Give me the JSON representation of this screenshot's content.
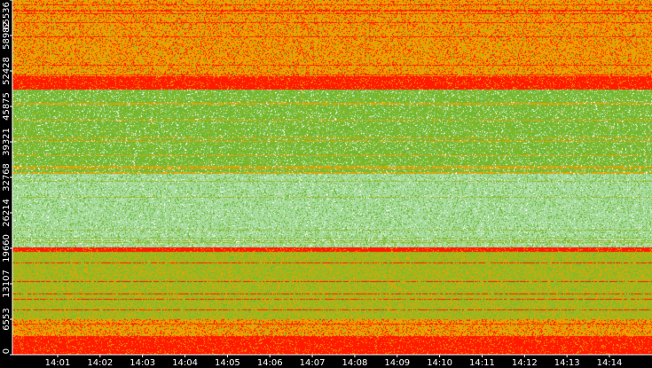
{
  "chart_data": {
    "type": "heatmap",
    "title": "",
    "xlabel": "",
    "ylabel": "",
    "x": {
      "tick_labels": [
        "14:01",
        "14:02",
        "14:03",
        "14:04",
        "14:05",
        "14:06",
        "14:07",
        "14:08",
        "14:09",
        "14:10",
        "14:11",
        "14:12",
        "14:13",
        "14:14"
      ],
      "range": [
        "14:00:15",
        "14:14:45"
      ]
    },
    "y": {
      "tick_labels": [
        "0",
        "6553",
        "13107",
        "19660",
        "26214",
        "32768",
        "39321",
        "45875",
        "52428",
        "58982",
        "65536"
      ],
      "tick_values": [
        0,
        6553,
        13107,
        19660,
        26214,
        32768,
        39321,
        45875,
        52428,
        58982,
        65536
      ],
      "range": [
        0,
        65536
      ]
    },
    "colors": {
      "low": "#a8dca0",
      "mid_low": "#6fb832",
      "mid": "#9cb81f",
      "mid_high": "#f0a000",
      "high": "#ff1a00",
      "background": "#000000"
    },
    "bands": [
      {
        "y_range": [
          0,
          3500
        ],
        "level": "high"
      },
      {
        "y_range": [
          3500,
          6500
        ],
        "level": "mid_high"
      },
      {
        "y_range": [
          6500,
          19000
        ],
        "level": "mid"
      },
      {
        "y_range": [
          19000,
          19900
        ],
        "level": "high"
      },
      {
        "y_range": [
          19900,
          33500
        ],
        "level": "low"
      },
      {
        "y_range": [
          33500,
          49000
        ],
        "level": "mid_low"
      },
      {
        "y_range": [
          49000,
          51500
        ],
        "level": "high"
      },
      {
        "y_range": [
          51500,
          65536
        ],
        "level": "mid_high"
      }
    ],
    "grid": false,
    "legend": "none"
  }
}
